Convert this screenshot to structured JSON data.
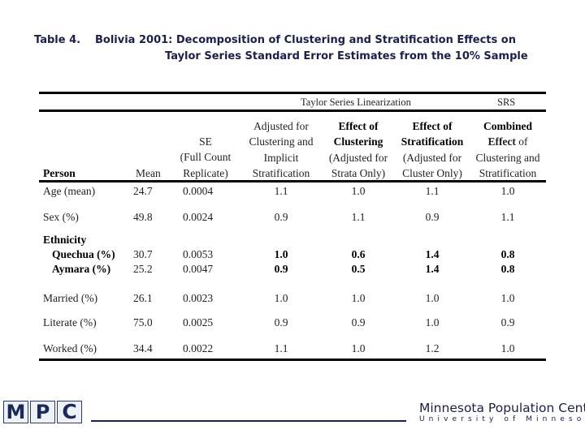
{
  "title": {
    "label": "Table 4.",
    "line1": "Bolivia 2001: Decomposition of Clustering and Stratification Effects on",
    "line2": "Taylor Series Standard Error Estimates from the 10% Sample"
  },
  "group_headers": {
    "taylor": "Taylor Series Linearization",
    "srs": "SRS"
  },
  "columns": {
    "person": "Person",
    "mean": "Mean",
    "se": [
      "SE",
      "(Full Count",
      "Replicate)"
    ],
    "adjusted": [
      "Adjusted for",
      "Clustering and",
      "Implicit",
      "Stratification"
    ],
    "clustering": [
      "Effect of",
      "Clustering",
      "(Adjusted for",
      "Strata Only)"
    ],
    "stratification": [
      "Effect of",
      "Stratification",
      "(Adjusted for",
      "Cluster Only)"
    ],
    "combined": [
      "Combined",
      "Effect",
      " of",
      "Clustering and",
      "Stratification"
    ]
  },
  "rows": [
    {
      "label": "Age (mean)",
      "mean": "24.7",
      "se": "0.0004",
      "adjusted": "1.1",
      "clustering": "1.0",
      "stratification": "1.1",
      "combined": "1.0"
    },
    {
      "label": "Sex (%)",
      "mean": "49.8",
      "se": "0.0024",
      "adjusted": "0.9",
      "clustering": "1.1",
      "stratification": "0.9",
      "combined": "1.1"
    },
    {
      "label": "Quechua (%)",
      "mean": "30.7",
      "se": "0.0053",
      "adjusted": "1.0",
      "clustering": "0.6",
      "stratification": "1.4",
      "combined": "0.8"
    },
    {
      "label": "Aymara (%)",
      "mean": "25.2",
      "se": "0.0047",
      "adjusted": "0.9",
      "clustering": "0.5",
      "stratification": "1.4",
      "combined": "0.8"
    },
    {
      "label": "Married (%)",
      "mean": "26.1",
      "se": "0.0023",
      "adjusted": "1.0",
      "clustering": "1.0",
      "stratification": "1.0",
      "combined": "1.0"
    },
    {
      "label": "Literate (%)",
      "mean": "75.0",
      "se": "0.0025",
      "adjusted": "0.9",
      "clustering": "0.9",
      "stratification": "1.0",
      "combined": "0.9"
    },
    {
      "label": "Worked (%)",
      "mean": "34.4",
      "se": "0.0022",
      "adjusted": "1.1",
      "clustering": "1.0",
      "stratification": "1.2",
      "combined": "1.0"
    }
  ],
  "ethnicity_label": "Ethnicity",
  "footer": {
    "logo_letters": [
      "M",
      "P",
      "C"
    ],
    "org_name": "Minnesota Population Center",
    "university": "University of Minnesota"
  }
}
